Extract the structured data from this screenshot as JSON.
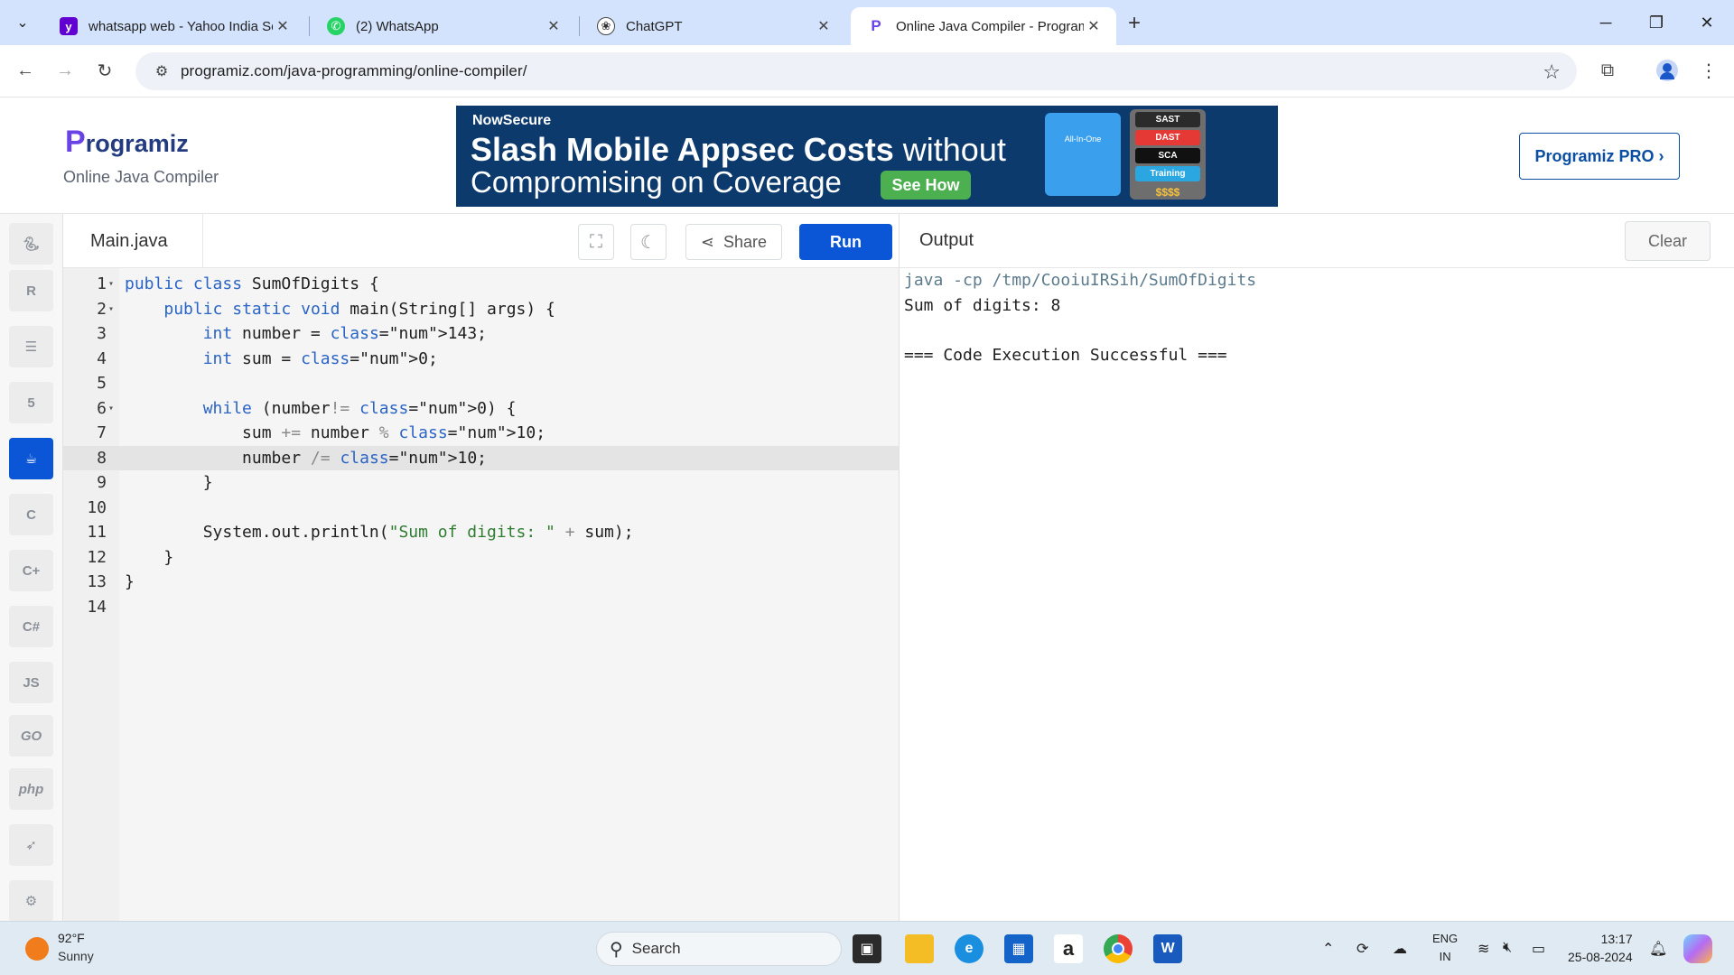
{
  "browser": {
    "tabs": [
      {
        "title": "whatsapp web - Yahoo India Se",
        "icon": "yahoo-icon",
        "color": "#6001d2"
      },
      {
        "title": "(2) WhatsApp",
        "icon": "whatsapp-icon",
        "color": "#25d366"
      },
      {
        "title": "ChatGPT",
        "icon": "chatgpt-icon",
        "color": "#333333"
      },
      {
        "title": "Online Java Compiler - Program",
        "icon": "programiz-icon",
        "color": "#6a43e6"
      }
    ],
    "url": "programiz.com/java-programming/online-compiler/"
  },
  "header": {
    "logo": "rogramiz",
    "logo_p": "P",
    "subtitle": "Online Java Compiler",
    "pro_button": "Programiz PRO ›"
  },
  "ad": {
    "brand": "NowSecure",
    "headline_bold": "Slash Mobile Appsec Costs",
    "headline_light": " without",
    "headline2": "Compromising on Coverage",
    "cta": "See How",
    "box1": "All-In-One",
    "box2_items": [
      "SAST",
      "DAST",
      "SCA",
      "Training"
    ],
    "total": "$$$$"
  },
  "languages": [
    "python",
    "r",
    "sql",
    "html",
    "java",
    "c",
    "cpp",
    "csharp",
    "js",
    "go",
    "php",
    "swift",
    "rust"
  ],
  "editor": {
    "filename": "Main.java",
    "share_label": "Share",
    "run_label": "Run",
    "current_line": 8,
    "lines": [
      "public class SumOfDigits {",
      "    public static void main(String[] args) {",
      "        int number = 143;",
      "        int sum = 0;",
      "",
      "        while (number!= 0) {",
      "            sum += number % 10;",
      "            number /= 10;",
      "        }",
      "",
      "        System.out.println(\"Sum of digits: \" + sum);",
      "    }",
      "}",
      ""
    ]
  },
  "output": {
    "title": "Output",
    "clear_label": "Clear",
    "lines": [
      "java -cp /tmp/CooiuIRSih/SumOfDigits",
      "Sum of digits: 8",
      "",
      "=== Code Execution Successful ==="
    ]
  },
  "taskbar": {
    "temperature": "92°F",
    "weather": "Sunny",
    "search_placeholder": "Search",
    "lang_line1": "ENG",
    "lang_line2": "IN",
    "time": "13:17",
    "date": "25-08-2024"
  }
}
